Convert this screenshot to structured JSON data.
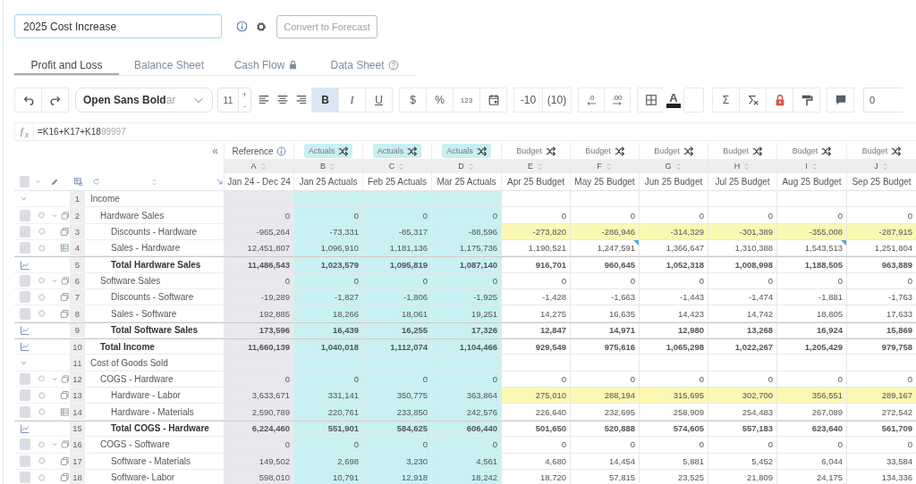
{
  "title_field": {
    "value": "2025 Cost Increase"
  },
  "convert_button": {
    "label": "Convert to Forecast",
    "disabled": true
  },
  "tabs": [
    {
      "label": "Profit and Loss",
      "selected": true
    },
    {
      "label": "Balance Sheet",
      "selected": false
    },
    {
      "label": "Cash Flow",
      "selected": false,
      "locked": true
    },
    {
      "label": "Data Sheet",
      "selected": false,
      "help": true
    }
  ],
  "toolbar": {
    "groups": [
      [
        {
          "kind": "undo"
        },
        {
          "kind": "redo"
        }
      ],
      [
        {
          "kind": "font",
          "value": "Open Sans Bold",
          "ghost": "ar"
        }
      ],
      [
        {
          "kind": "size",
          "value": "11",
          "plus": "+",
          "minus": "-"
        }
      ],
      [
        {
          "kind": "align-left"
        },
        {
          "kind": "align-center"
        },
        {
          "kind": "align-right"
        }
      ],
      [
        {
          "kind": "bold",
          "label": "B",
          "selected": true
        },
        {
          "kind": "italic",
          "label": "I",
          "selected": false
        },
        {
          "kind": "underline",
          "label": "U",
          "selected": false
        }
      ],
      [
        {
          "kind": "text",
          "label": "$"
        },
        {
          "kind": "text",
          "label": "%"
        },
        {
          "kind": "small",
          "label": "123"
        },
        {
          "kind": "calendar"
        }
      ],
      [
        {
          "kind": "text",
          "label": "-10"
        },
        {
          "kind": "text",
          "label": "(10)"
        }
      ],
      [
        {
          "kind": "decimal",
          "label": ".0"
        },
        {
          "kind": "decimal",
          "label": ".00"
        }
      ],
      [
        {
          "kind": "borders"
        },
        {
          "kind": "font-color",
          "label": "A"
        },
        {
          "kind": "fill"
        }
      ],
      [
        {
          "kind": "text",
          "label": "Σ"
        },
        {
          "kind": "clear"
        },
        {
          "kind": "lock"
        },
        {
          "kind": "painter"
        }
      ],
      [
        {
          "kind": "comment"
        }
      ],
      [
        {
          "kind": "number-field",
          "value": "0"
        }
      ]
    ]
  },
  "formula": {
    "label": "ƒ$_{x}$",
    "value": "=K16+K17+K18",
    "ghost": "99997"
  },
  "grid": {
    "collapse": "«",
    "select_all": {
      "checked": false
    },
    "columns": [
      {
        "letter": "A",
        "kind": "reference",
        "type_label": "Reference",
        "name": "Jan 24 - Dec 24"
      },
      {
        "letter": "B",
        "kind": "actual",
        "type_label": "Actuals",
        "name": "Jan 25 Actuals"
      },
      {
        "letter": "C",
        "kind": "actual",
        "type_label": "Actuals",
        "name": "Feb 25 Actuals"
      },
      {
        "letter": "D",
        "kind": "actual",
        "type_label": "Actuals",
        "name": "Mar 25 Actuals"
      },
      {
        "letter": "E",
        "kind": "budget",
        "type_label": "Budget",
        "name": "Apr 25 Budget"
      },
      {
        "letter": "F",
        "kind": "budget",
        "type_label": "Budget",
        "name": "May 25 Budget"
      },
      {
        "letter": "G",
        "kind": "budget",
        "type_label": "Budget",
        "name": "Jun 25 Budget"
      },
      {
        "letter": "H",
        "kind": "budget",
        "type_label": "Budget",
        "name": "Jul 25 Budget"
      },
      {
        "letter": "I",
        "kind": "budget",
        "type_label": "Budget",
        "name": "Aug 25 Budget"
      },
      {
        "letter": "J",
        "kind": "budget",
        "type_label": "Budget",
        "name": "Sep 25 Budget"
      }
    ],
    "rows": [
      {
        "number": "1",
        "label": "Income",
        "kind": "section",
        "expanded": true,
        "children": [
          {
            "number": "2",
            "label": "Hardware Sales",
            "kind": "group",
            "expanded": true,
            "checked": false,
            "values": [
              "0",
              "0",
              "0",
              "0",
              "0",
              "0",
              "0",
              "0",
              "0",
              "0"
            ],
            "children": [
              {
                "number": "3",
                "label": "Discounts - Hardware",
                "kind": "entry",
                "highlight": true,
                "checked": false,
                "values": [
                  "-965,264",
                  "-73,331",
                  "-85,317",
                  "-88,596",
                  "-273,820",
                  "-286,946",
                  "-314,329",
                  "-301,389",
                  "-355,008",
                  "-287,915"
                ]
              },
              {
                "number": "4",
                "label": "Sales - Hardware",
                "kind": "sheet-entry",
                "highlight": false,
                "checked": false,
                "flagged": [
                  false,
                  false,
                  false,
                  false,
                  false,
                  true,
                  false,
                  false,
                  true,
                  false
                ],
                "values": [
                  "12,451,807",
                  "1,096,910",
                  "1,181,136",
                  "1,175,736",
                  "1,190,521",
                  "1,247,591",
                  "1,366,647",
                  "1,310,388",
                  "1,543,513",
                  "1,251,804"
                ]
              },
              {
                "number": "5",
                "label": "Total Hardware Sales",
                "kind": "total",
                "values": [
                  "11,486,543",
                  "1,023,579",
                  "1,095,819",
                  "1,087,140",
                  "916,701",
                  "960,645",
                  "1,052,318",
                  "1,008,998",
                  "1,188,505",
                  "963,889"
                ]
              }
            ]
          },
          {
            "number": "6",
            "label": "Software Sales",
            "kind": "group",
            "expanded": true,
            "checked": false,
            "values": [
              "0",
              "0",
              "0",
              "0",
              "0",
              "0",
              "0",
              "0",
              "0",
              "0"
            ],
            "children": [
              {
                "number": "7",
                "label": "Discounts - Software",
                "kind": "entry",
                "highlight": false,
                "checked": false,
                "values": [
                  "-19,289",
                  "-1,827",
                  "-1,806",
                  "-1,925",
                  "-1,428",
                  "-1,663",
                  "-1,443",
                  "-1,474",
                  "-1,881",
                  "-1,763"
                ]
              },
              {
                "number": "8",
                "label": "Sales - Software",
                "kind": "entry",
                "highlight": false,
                "checked": false,
                "values": [
                  "192,885",
                  "18,266",
                  "18,061",
                  "19,251",
                  "14,275",
                  "16,635",
                  "14,423",
                  "14,742",
                  "18,805",
                  "17,633"
                ]
              },
              {
                "number": "9",
                "label": "Total Software Sales",
                "kind": "total",
                "values": [
                  "173,596",
                  "16,439",
                  "16,255",
                  "17,326",
                  "12,847",
                  "14,971",
                  "12,980",
                  "13,268",
                  "16,924",
                  "15,869"
                ]
              }
            ]
          },
          {
            "number": "10",
            "label": "Total Income",
            "kind": "total",
            "values": [
              "11,660,139",
              "1,040,018",
              "1,112,074",
              "1,104,466",
              "929,549",
              "975,616",
              "1,065,298",
              "1,022,267",
              "1,205,429",
              "979,758"
            ]
          }
        ]
      },
      {
        "number": "11",
        "label": "Cost of Goods Sold",
        "kind": "section",
        "expanded": true,
        "children": [
          {
            "number": "12",
            "label": "COGS - Hardware",
            "kind": "group",
            "expanded": true,
            "checked": false,
            "values": [
              "0",
              "0",
              "0",
              "0",
              "0",
              "0",
              "0",
              "0",
              "0",
              "0"
            ],
            "children": [
              {
                "number": "13",
                "label": "Hardware - Labor",
                "kind": "entry",
                "highlight": true,
                "checked": false,
                "values": [
                  "3,633,671",
                  "331,141",
                  "350,775",
                  "363,864",
                  "275,010",
                  "288,194",
                  "315,695",
                  "302,700",
                  "356,551",
                  "289,167"
                ]
              },
              {
                "number": "14",
                "label": "Hardware - Materials",
                "kind": "sheet-entry",
                "highlight": false,
                "checked": false,
                "values": [
                  "2,590,789",
                  "220,761",
                  "233,850",
                  "242,576",
                  "226,640",
                  "232,695",
                  "258,909",
                  "254,483",
                  "267,089",
                  "272,542"
                ]
              },
              {
                "number": "15",
                "label": "Total COGS - Hardware",
                "kind": "total",
                "values": [
                  "6,224,460",
                  "551,901",
                  "584,625",
                  "606,440",
                  "501,650",
                  "520,888",
                  "574,605",
                  "557,183",
                  "623,640",
                  "561,709"
                ]
              }
            ]
          },
          {
            "number": "16",
            "label": "COGS - Software",
            "kind": "group",
            "expanded": true,
            "checked": false,
            "values": [
              "0",
              "0",
              "0",
              "0",
              "0",
              "0",
              "0",
              "0",
              "0",
              "0"
            ],
            "children": [
              {
                "number": "17",
                "label": "Software - Materials",
                "kind": "entry",
                "highlight": false,
                "checked": false,
                "values": [
                  "149,502",
                  "2,698",
                  "3,230",
                  "4,561",
                  "4,680",
                  "14,454",
                  "5,881",
                  "5,452",
                  "6,044",
                  "33,584"
                ]
              },
              {
                "number": "18",
                "label": "Software- Labor",
                "kind": "entry",
                "highlight": false,
                "checked": false,
                "values": [
                  "598,010",
                  "10,791",
                  "12,918",
                  "18,242",
                  "18,720",
                  "57,815",
                  "23,525",
                  "21,809",
                  "24,175",
                  "134,336"
                ]
              }
            ]
          }
        ]
      }
    ]
  }
}
